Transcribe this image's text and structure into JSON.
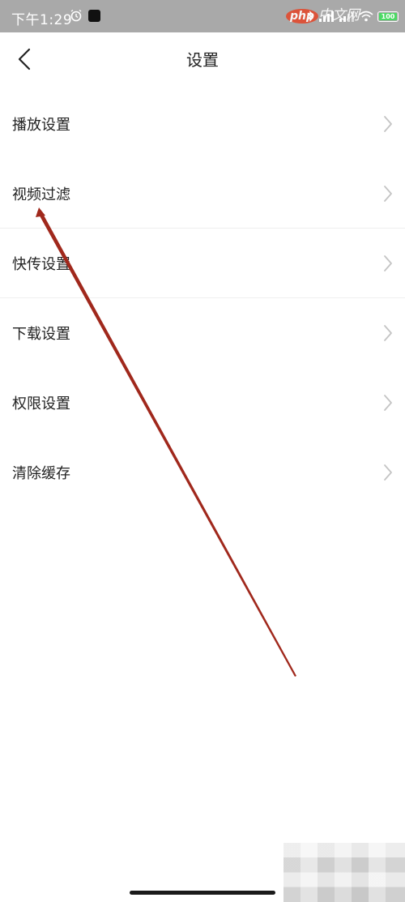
{
  "status_bar": {
    "time": "下午1:29",
    "icons": [
      "alarm-icon",
      "notification-icon",
      "bluetooth-icon",
      "signal-icon",
      "signal-icon-2",
      "wifi-icon",
      "battery-icon"
    ],
    "battery_level": "100"
  },
  "watermark": {
    "php": "php",
    "text": "中文网"
  },
  "header": {
    "title": "设置",
    "back_icon": "chevron-left-icon"
  },
  "settings": {
    "items": [
      {
        "label": "播放设置"
      },
      {
        "label": "视频过滤"
      },
      {
        "label": "快传设置"
      },
      {
        "label": "下载设置"
      },
      {
        "label": "权限设置"
      },
      {
        "label": "清除缓存"
      }
    ],
    "chevron_icon": "chevron-right-icon"
  },
  "annotation": {
    "type": "arrow",
    "color": "#a0281c"
  }
}
